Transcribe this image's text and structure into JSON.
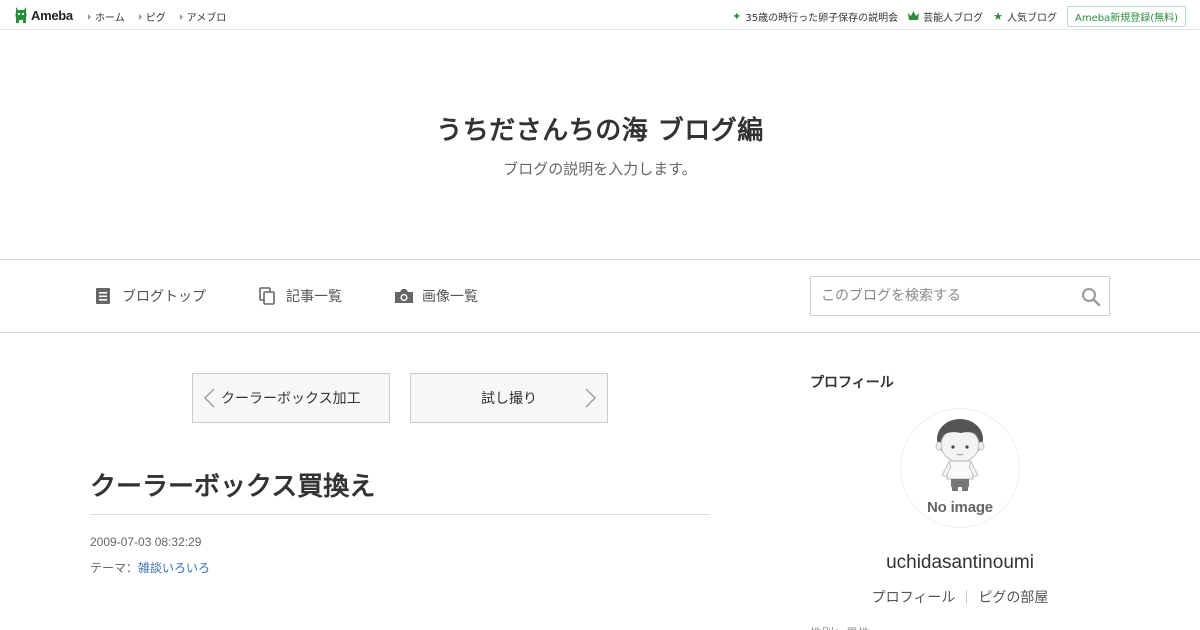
{
  "topbar": {
    "logo_text": "Ameba",
    "nav": [
      "ホーム",
      "ピグ",
      "アメブロ"
    ],
    "right_links": [
      {
        "label": "35歳の時行った卵子保存の説明会",
        "icon": "sparkle-icon"
      },
      {
        "label": "芸能人ブログ",
        "icon": "crown-icon"
      },
      {
        "label": "人気ブログ",
        "icon": "star-icon"
      }
    ],
    "register_label": "Ameba新規登録(無料)"
  },
  "header": {
    "title": "うちださんちの海 ブログ編",
    "description": "ブログの説明を入力します。"
  },
  "navbar": {
    "items": [
      {
        "label": "ブログトップ",
        "icon": "document-icon"
      },
      {
        "label": "記事一覧",
        "icon": "copy-icon"
      },
      {
        "label": "画像一覧",
        "icon": "camera-icon"
      }
    ],
    "search_placeholder": "このブログを検索する"
  },
  "pager": {
    "prev_label": "クーラーボックス加工",
    "next_label": "試し撮り"
  },
  "article": {
    "title": "クーラーボックス買換え",
    "date": "2009-07-03 08:32:29",
    "theme_prefix": "テーマ：",
    "theme": "雑談いろいろ"
  },
  "sidebar": {
    "heading": "プロフィール",
    "avatar_text": "No image",
    "username": "uchidasantinoumi",
    "links": [
      "プロフィール",
      "ピグの部屋"
    ],
    "cut_text": "性別：男性"
  },
  "colors": {
    "ameba_green": "#2d8c3c",
    "link_blue": "#3a6fb0"
  }
}
